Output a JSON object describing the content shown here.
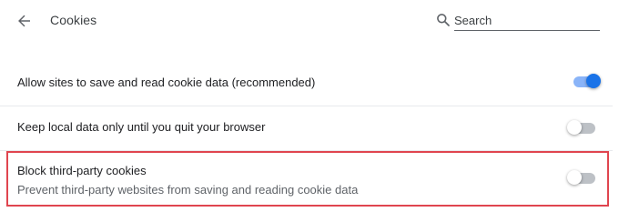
{
  "header": {
    "title": "Cookies",
    "back_icon": "arrow-back-icon",
    "search_icon": "search-icon",
    "search_placeholder": "Search",
    "search_value": ""
  },
  "settings": [
    {
      "label": "Allow sites to save and read cookie data (recommended)",
      "sublabel": "",
      "enabled": true
    },
    {
      "label": "Keep local data only until you quit your browser",
      "sublabel": "",
      "enabled": false
    },
    {
      "label": "Block third-party cookies",
      "sublabel": "Prevent third-party websites from saving and reading cookie data",
      "enabled": false,
      "highlighted": true
    }
  ],
  "colors": {
    "accent": "#1a73e8",
    "accent_track": "#8ab4f8",
    "highlight_border": "#e0454f"
  }
}
